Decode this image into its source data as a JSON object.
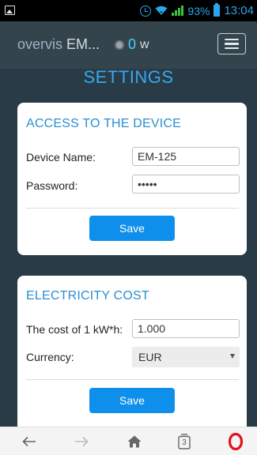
{
  "status_bar": {
    "battery_percent": "93%",
    "time": "13:04",
    "icons": [
      "gallery-icon",
      "alarm-icon",
      "wifi-icon",
      "signal-icon",
      "battery-icon"
    ]
  },
  "header": {
    "brand_prefix": "overvis",
    "brand_suffix": " EM...",
    "power_value": "0",
    "power_unit": "w",
    "menu_icon": "hamburger-menu-icon"
  },
  "page": {
    "title": "SETTINGS"
  },
  "access_section": {
    "title": "ACCESS TO THE DEVICE",
    "device_name_label": "Device Name:",
    "device_name_value": "EM-125",
    "password_label": "Password:",
    "password_value": "12345",
    "save_label": "Save"
  },
  "cost_section": {
    "title": "ELECTRICITY COST",
    "cost_label": "The cost of 1 kW*h:",
    "cost_value": "1.000",
    "currency_label": "Currency:",
    "currency_value": "EUR",
    "save_label": "Save"
  },
  "bottom_nav": {
    "items": [
      "back-arrow-icon",
      "forward-arrow-icon",
      "home-icon",
      "tabs-icon",
      "opera-icon"
    ],
    "tabs_count": "3"
  },
  "colors": {
    "accent": "#0f8fec",
    "title_blue": "#38a8ef",
    "background": "#283b47",
    "opera_red": "#e2111b"
  }
}
